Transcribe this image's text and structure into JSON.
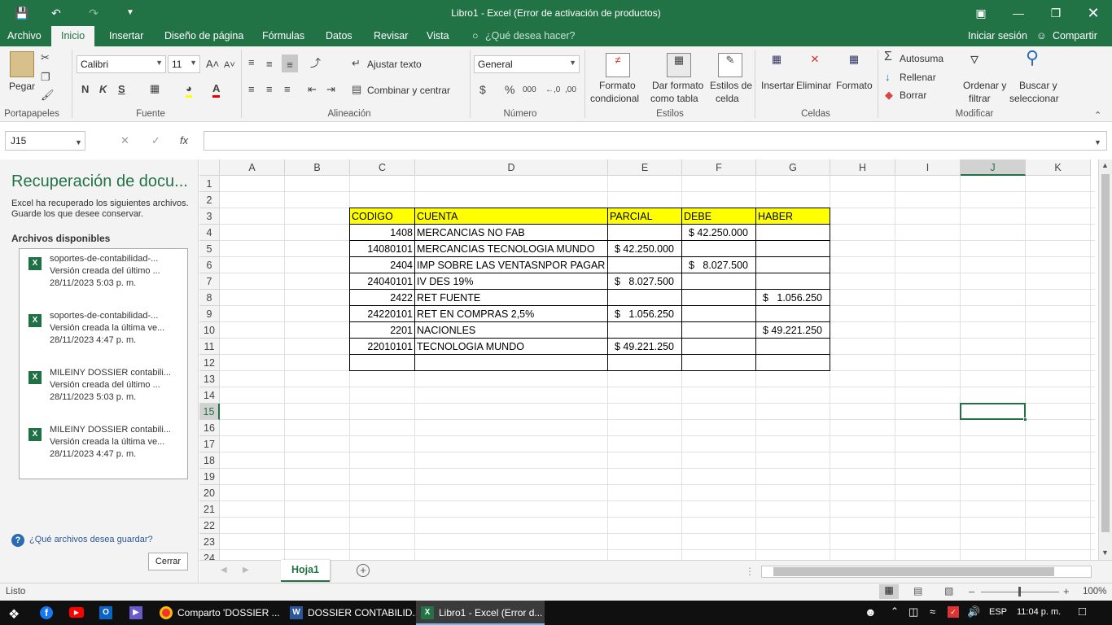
{
  "window": {
    "title": "Libro1 - Excel (Error de activación de productos)"
  },
  "menu": {
    "tabs": [
      "Archivo",
      "Inicio",
      "Insertar",
      "Diseño de página",
      "Fórmulas",
      "Datos",
      "Revisar",
      "Vista"
    ],
    "tell_me": "¿Qué desea hacer?",
    "signin": "Iniciar sesión",
    "share": "Compartir"
  },
  "ribbon": {
    "clipboard": {
      "paste": "Pegar",
      "label": "Portapapeles"
    },
    "font": {
      "name": "Calibri",
      "size": "11",
      "bold": "N",
      "italic": "K",
      "underline": "S",
      "label": "Fuente"
    },
    "alignment": {
      "wrap": "Ajustar texto",
      "merge": "Combinar y centrar",
      "label": "Alineación"
    },
    "number": {
      "format": "General",
      "currency": "$",
      "percent": "%",
      "thousands": "000",
      "label": "Número"
    },
    "styles": {
      "conditional_1": "Formato",
      "conditional_2": "condicional",
      "table_1": "Dar formato",
      "table_2": "como tabla",
      "cell_1": "Estilos de",
      "cell_2": "celda",
      "label": "Estilos"
    },
    "cells": {
      "insert": "Insertar",
      "delete": "Eliminar",
      "format": "Formato",
      "label": "Celdas"
    },
    "editing": {
      "autosum": "Autosuma",
      "fill": "Rellenar",
      "clear": "Borrar",
      "sort_1": "Ordenar y",
      "sort_2": "filtrar",
      "find_1": "Buscar y",
      "find_2": "seleccionar",
      "label": "Modificar"
    }
  },
  "formula_bar": {
    "name_box": "J15",
    "fx": "fx",
    "formula": ""
  },
  "recovery": {
    "title": "Recuperación de docu...",
    "description": "Excel ha recuperado los siguientes archivos. Guarde los que desee conservar.",
    "available_label": "Archivos disponibles",
    "files": [
      {
        "name": "soportes-de-contabilidad-...",
        "version": "Versión creada del último ...",
        "date": "28/11/2023 5:03 p. m."
      },
      {
        "name": "soportes-de-contabilidad-...",
        "version": "Versión creada la última ve...",
        "date": "28/11/2023 4:47 p. m."
      },
      {
        "name": "MILEINY DOSSIER contabili...",
        "version": "Versión creada del último ...",
        "date": "28/11/2023 5:03 p. m."
      },
      {
        "name": "MILEINY DOSSIER contabili...",
        "version": "Versión creada la última ve...",
        "date": "28/11/2023 4:47 p. m."
      }
    ],
    "help_link": "¿Qué archivos desea guardar?",
    "close": "Cerrar"
  },
  "grid": {
    "columns": [
      "A",
      "B",
      "C",
      "D",
      "E",
      "F",
      "G",
      "H",
      "I",
      "J",
      "K"
    ],
    "rows": [
      "1",
      "2",
      "3",
      "4",
      "5",
      "6",
      "7",
      "8",
      "9",
      "10",
      "11",
      "12",
      "13",
      "14",
      "15",
      "16",
      "17",
      "18",
      "19",
      "20",
      "21",
      "22",
      "23",
      "24"
    ],
    "headers": {
      "codigo": "CODIGO",
      "cuenta": "CUENTA",
      "parcial": "PARCIAL",
      "debe": "DEBE",
      "haber": "HABER"
    },
    "entries": [
      {
        "codigo": "1408",
        "cuenta": "MERCANCIAS NO FAB",
        "parcial": "",
        "debe": "$ 42.250.000",
        "haber": ""
      },
      {
        "codigo": "14080101",
        "cuenta": "MERCANCIAS TECNOLOGIA MUNDO",
        "parcial": "$ 42.250.000",
        "debe": "",
        "haber": ""
      },
      {
        "codigo": "2404",
        "cuenta": "IMP SOBRE LAS VENTASNPOR PAGAR",
        "parcial": "",
        "debe": "$   8.027.500",
        "haber": ""
      },
      {
        "codigo": "24040101",
        "cuenta": "IV DES 19%",
        "parcial": "$   8.027.500",
        "debe": "",
        "haber": ""
      },
      {
        "codigo": "2422",
        "cuenta": "RET FUENTE",
        "parcial": "",
        "debe": "",
        "haber": "$   1.056.250"
      },
      {
        "codigo": "24220101",
        "cuenta": "RET EN COMPRAS 2,5%",
        "parcial": "$   1.056.250",
        "debe": "",
        "haber": ""
      },
      {
        "codigo": "2201",
        "cuenta": "NACIONLES",
        "parcial": "",
        "debe": "",
        "haber": "$ 49.221.250"
      },
      {
        "codigo": "22010101",
        "cuenta": "TECNOLOGIA MUNDO",
        "parcial": "$ 49.221.250",
        "debe": "",
        "haber": ""
      },
      {
        "codigo": "",
        "cuenta": "",
        "parcial": "",
        "debe": "",
        "haber": ""
      }
    ],
    "selected_cell": "J15"
  },
  "sheets": {
    "active": "Hoja1"
  },
  "status": {
    "text": "Listo",
    "zoom": "100%"
  },
  "taskbar": {
    "items": [
      "Comparto 'DOSSIER ...",
      "DOSSIER CONTABILID...",
      "Libro1 - Excel (Error d..."
    ],
    "lang": "ESP",
    "time": "11:04 p. m."
  }
}
